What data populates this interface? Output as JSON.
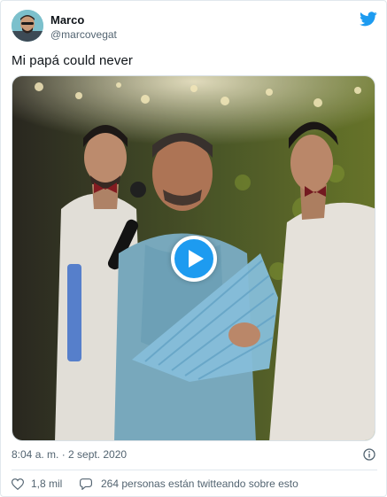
{
  "tweet": {
    "author_name": "Marco",
    "author_handle": "@marcovegat",
    "text": "Mi papá could never",
    "timestamp": "8:04 a. m. · 2 sept. 2020",
    "likes": "1,8 mil",
    "conversation": "264 personas están twitteando sobre esto"
  },
  "colors": {
    "brand": "#1d9bf0",
    "text_primary": "#0f1419",
    "text_secondary": "#536471",
    "border": "#e1e8ed"
  },
  "icons": {
    "logo": "twitter-bird-icon",
    "play": "play-icon",
    "info": "info-icon",
    "like": "heart-icon",
    "reply": "speech-bubble-icon"
  }
}
